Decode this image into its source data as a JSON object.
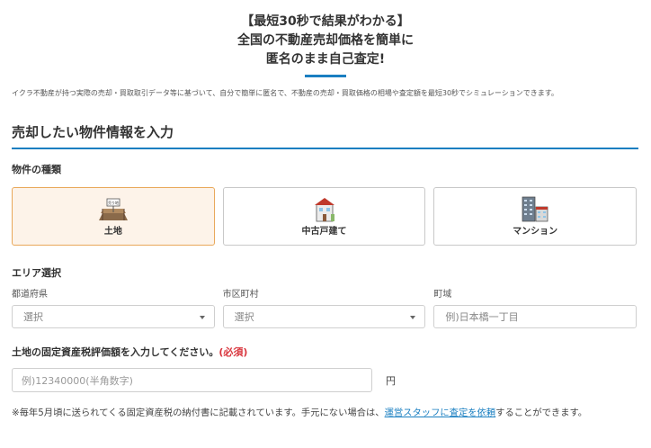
{
  "hero": {
    "line1": "【最短30秒で結果がわかる】",
    "line2": "全国の不動産売却価格を簡単に",
    "line3": "匿名のまま自己査定!"
  },
  "lead": "イクラ不動産が持つ実際の売却・買取取引データ等に基づいて、自分で簡単に匿名で、不動産の売却・買取価格の相場や査定額を最短30秒でシミュレーションできます。",
  "section_title": "売却したい物件情報を入力",
  "property_type": {
    "label": "物件の種類",
    "options": [
      {
        "label": "土地",
        "icon": "land-icon",
        "selected": true
      },
      {
        "label": "中古戸建て",
        "icon": "house-icon",
        "selected": false
      },
      {
        "label": "マンション",
        "icon": "mansion-icon",
        "selected": false
      }
    ],
    "land_sign": "売り地"
  },
  "area": {
    "label": "エリア選択",
    "prefecture_label": "都道府県",
    "prefecture_value": "選択",
    "city_label": "市区町村",
    "city_value": "選択",
    "town_label": "町域",
    "town_placeholder": "例)日本橋一丁目"
  },
  "tax_value": {
    "label": "土地の固定資産税評価額を入力してください。",
    "required": "(必須)",
    "placeholder": "例)12340000(半角数字)",
    "unit": "円"
  },
  "note": {
    "before": "※毎年5月頃に送られてくる固定資産税の納付書に記載されています。手元にない場合は、",
    "link": "運営スタッフに査定を依頼",
    "after": "することができます。"
  },
  "colors": {
    "accent": "#1a7fc1",
    "selected_bg": "#fdf3e9",
    "selected_border": "#e9a85a",
    "required": "#d9363e"
  }
}
